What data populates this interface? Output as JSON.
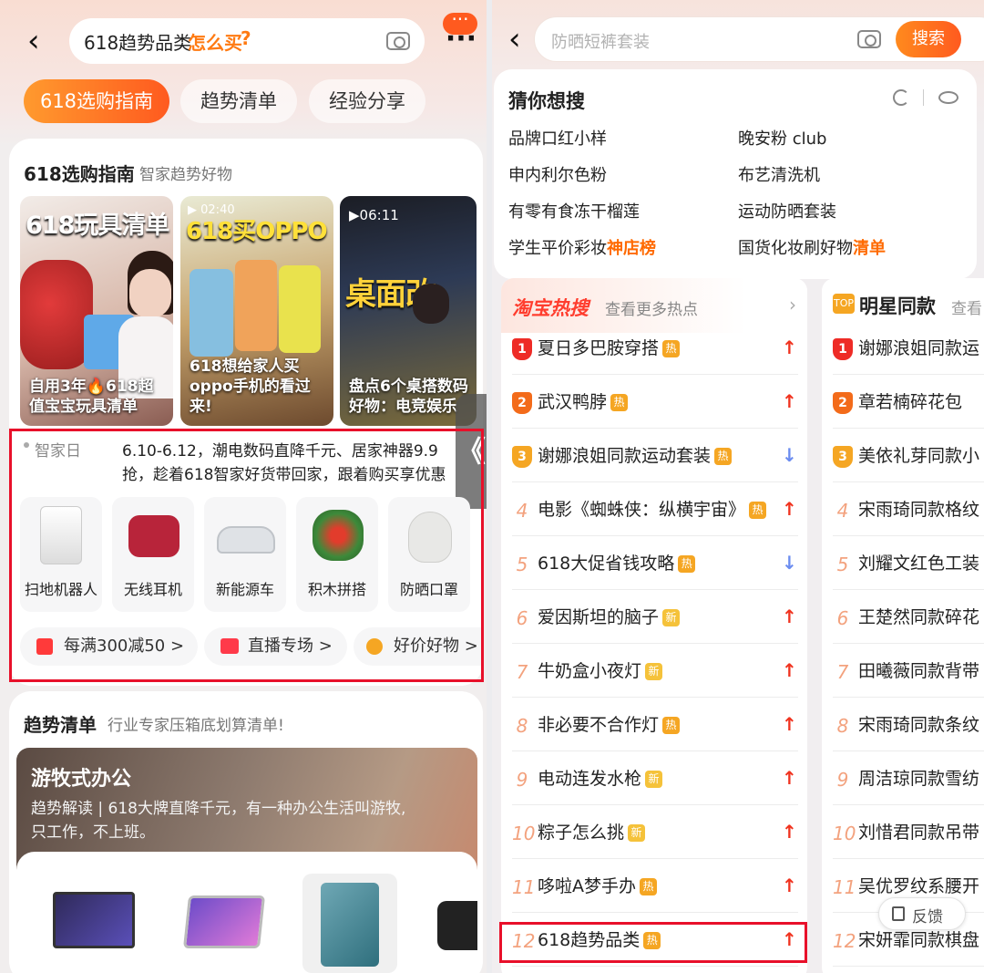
{
  "left": {
    "search_text": "618趋势品类",
    "search_suffix": "怎么买",
    "tabs": [
      "618选购指南",
      "趋势清单",
      "经验分享"
    ],
    "guide": {
      "title": "618选购指南",
      "subtitle": "智家趋势好物",
      "videos": [
        {
          "overlay": "618玩具清单",
          "caption": "自用3年🔥618超值宝宝玩具清单"
        },
        {
          "overlay": "618买OPPO",
          "duration": "02:40",
          "caption": "618想给家人买oppo手机的看过来!"
        },
        {
          "overlay": "桌面改",
          "duration": "06:11",
          "caption": "盘点6个桌搭数码好物：电竞娱乐"
        }
      ]
    },
    "promo": {
      "label": "智家日",
      "text_line1": "6.10-6.12，潮电数码直降千元、居家神器9.9",
      "text_line2": "抢，趁着618智家好货带回家，跟着购买享优惠",
      "side_handle": "《"
    },
    "categories": [
      "扫地机器人",
      "无线耳机",
      "新能源车",
      "积木拼搭",
      "防晒口罩"
    ],
    "chips": [
      "每满300减50 >",
      "直播专场 >",
      "好价好物 >"
    ],
    "trend": {
      "title": "趋势清单",
      "subtitle": "行业专家压箱底划算清单!",
      "banner_title": "游牧式办公",
      "banner_line1": "趋势解读 | 618大牌直降千元，有一种办公生活叫游牧,",
      "banner_line2": "只工作，不上班。"
    }
  },
  "right": {
    "search_placeholder": "防晒短裤套装",
    "search_button": "搜索",
    "guess": {
      "title": "猜你想搜",
      "items": [
        {
          "text": "品牌口红小样",
          "hl": ""
        },
        {
          "text": "晚安粉 club",
          "hl": ""
        },
        {
          "text": "申内利尔色粉",
          "hl": ""
        },
        {
          "text": "布艺清洗机",
          "hl": ""
        },
        {
          "text": "有零有食冻干榴莲",
          "hl": ""
        },
        {
          "text": "运动防晒套装",
          "hl": ""
        },
        {
          "text": "学生平价彩妆",
          "hl": "神店榜"
        },
        {
          "text": "国货化妆刷好物",
          "hl": "清单"
        }
      ]
    },
    "hot": {
      "title": "淘宝热搜",
      "more": "查看更多热点",
      "items": [
        {
          "rank": "1",
          "text": "夏日多巴胺穿搭",
          "tag": "热",
          "trend": "up"
        },
        {
          "rank": "2",
          "text": "武汉鸭脖",
          "tag": "热",
          "trend": "up"
        },
        {
          "rank": "3",
          "text": "谢娜浪姐同款运动套装",
          "tag": "热",
          "trend": "down"
        },
        {
          "rank": "4",
          "text": "电影《蜘蛛侠：纵横宇宙》",
          "tag": "热",
          "trend": "up"
        },
        {
          "rank": "5",
          "text": "618大促省钱攻略",
          "tag": "热",
          "trend": "down"
        },
        {
          "rank": "6",
          "text": "爱因斯坦的脑子",
          "tag": "新",
          "trend": "up"
        },
        {
          "rank": "7",
          "text": "牛奶盒小夜灯",
          "tag": "新",
          "trend": "up"
        },
        {
          "rank": "8",
          "text": "非必要不合作灯",
          "tag": "热",
          "trend": "up"
        },
        {
          "rank": "9",
          "text": "电动连发水枪",
          "tag": "新",
          "trend": "up"
        },
        {
          "rank": "10",
          "text": "粽子怎么挑",
          "tag": "新",
          "trend": "up"
        },
        {
          "rank": "11",
          "text": "哆啦A梦手办",
          "tag": "热",
          "trend": "up"
        },
        {
          "rank": "12",
          "text": "618趋势品类",
          "tag": "热",
          "trend": "up"
        }
      ]
    },
    "star": {
      "title": "明星同款",
      "more": "查看",
      "items": [
        "谢娜浪姐同款运",
        "章若楠碎花包",
        "美依礼芽同款小",
        "宋雨琦同款格纹",
        "刘耀文红色工装",
        "王楚然同款碎花",
        "田曦薇同款背带",
        "宋雨琦同款条纹",
        "周洁琼同款雪纺",
        "刘惜君同款吊带",
        "吴优罗纹系腰开",
        "宋妍霏同款棋盘"
      ]
    },
    "feedback": "反馈"
  },
  "colors": {
    "accent": "#ff5a1f",
    "red": "#e8102a",
    "up": "#f0331f",
    "down": "#6b8cf0"
  }
}
